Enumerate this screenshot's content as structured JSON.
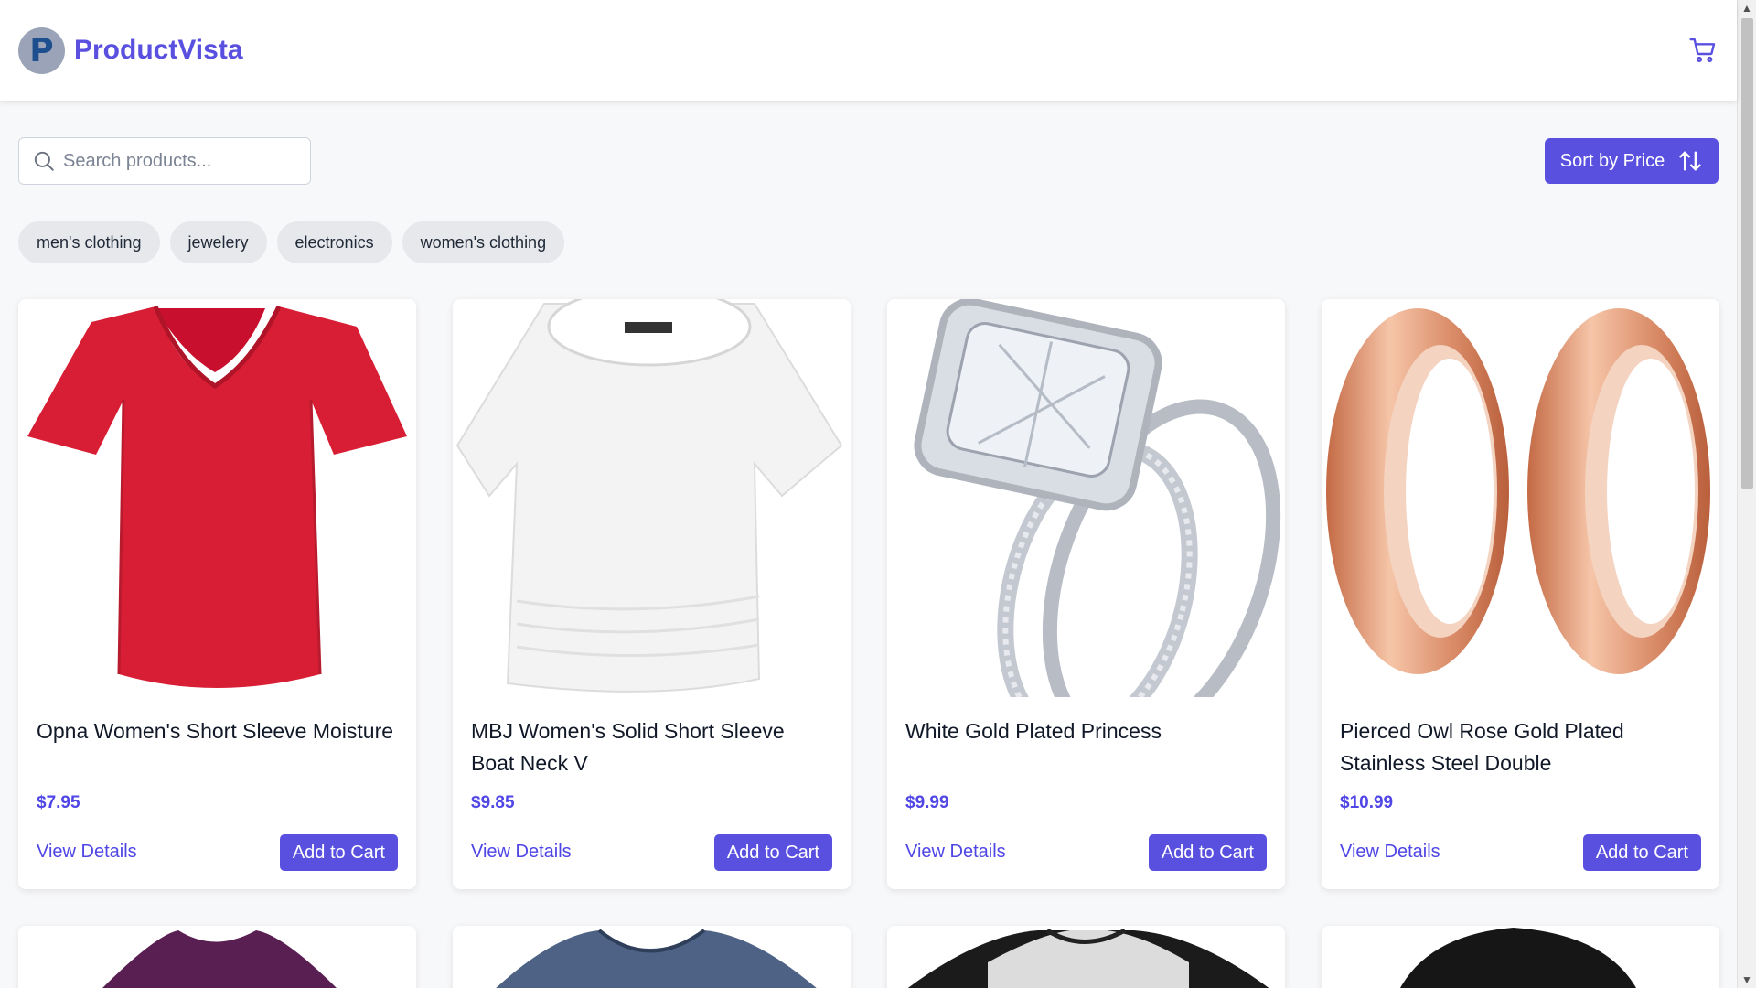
{
  "header": {
    "logo_letter": "P",
    "brand": "ProductVista",
    "cart_icon": "cart-icon"
  },
  "toolbar": {
    "search_placeholder": "Search products...",
    "sort_label": "Sort by Price",
    "sort_icon": "sort-arrows-icon"
  },
  "categories": [
    "men's clothing",
    "jewelery",
    "electronics",
    "women's clothing"
  ],
  "products": [
    {
      "title": "Opna Women's Short Sleeve Moisture",
      "price": "$7.95",
      "details_label": "View Details",
      "cart_label": "Add to Cart",
      "image": "red-vneck-tshirt"
    },
    {
      "title": "MBJ Women's Solid Short Sleeve Boat Neck V",
      "price": "$9.85",
      "details_label": "View Details",
      "cart_label": "Add to Cart",
      "image": "white-boatneck-top"
    },
    {
      "title": "White Gold Plated Princess",
      "price": "$9.99",
      "details_label": "View Details",
      "cart_label": "Add to Cart",
      "image": "diamond-ring-set"
    },
    {
      "title": "Pierced Owl Rose Gold Plated Stainless Steel Double",
      "price": "$10.99",
      "details_label": "View Details",
      "cart_label": "Add to Cart",
      "image": "rose-gold-tunnels"
    }
  ],
  "next_row_images": [
    "purple-tshirt",
    "blue-vneck-tshirt",
    "raglan-henley",
    "black-hoodie"
  ],
  "colors": {
    "accent": "#5a50e0",
    "price": "#4f46e5",
    "chip_bg": "#e6e8ec",
    "page_bg": "#f7f8fa"
  }
}
